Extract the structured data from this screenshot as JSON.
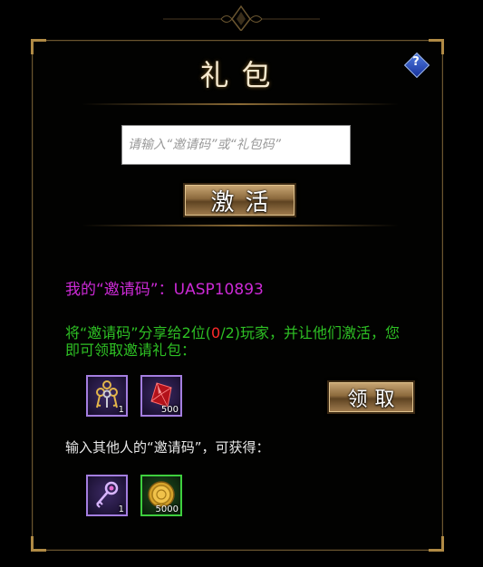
{
  "title": "礼包",
  "help_label": "?",
  "input": {
    "placeholder": "请输入“邀请码”或“礼包码”",
    "value": ""
  },
  "activate_label": "激活",
  "my_code": {
    "label": "我的“邀请码”：",
    "code": "UASP10893"
  },
  "share": {
    "prefix": "将“邀请码”分享给2位(",
    "current": "0",
    "suffix": "/2)玩家，并让他们激活，您即可领取邀请礼包："
  },
  "invite_rewards": [
    {
      "icon": "key-bundle-icon",
      "count": "1"
    },
    {
      "icon": "red-gem-icon",
      "count": "500"
    }
  ],
  "claim_label": "领取",
  "enter_text": "输入其他人的“邀请码”，可获得：",
  "enter_rewards": [
    {
      "icon": "key-icon",
      "count": "1"
    },
    {
      "icon": "gold-coin-icon",
      "count": "5000"
    }
  ],
  "colors": {
    "code_text": "#cc2ad6",
    "share_text": "#2ec024",
    "highlight": "#ff2a2a",
    "gold_border": "#b08a45"
  }
}
